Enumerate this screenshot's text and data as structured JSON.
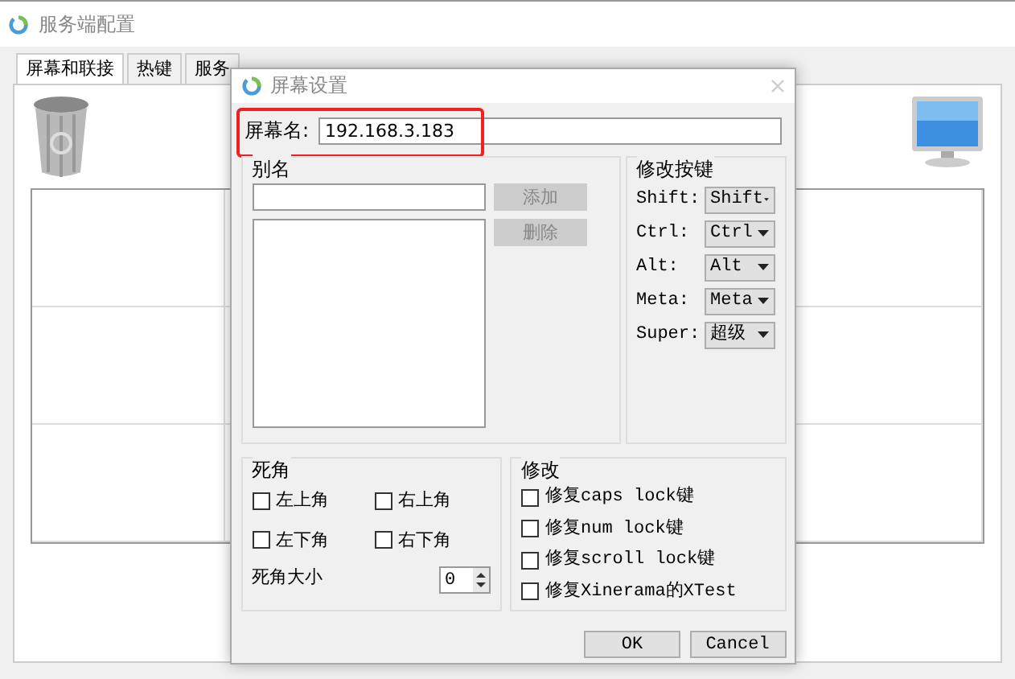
{
  "main_window": {
    "title": "服务端配置",
    "tabs": [
      {
        "label": "屏幕和联接",
        "selected": true
      },
      {
        "label": "热键",
        "selected": false
      },
      {
        "label": "服务",
        "selected": false
      }
    ]
  },
  "dialog": {
    "title": "屏幕设置",
    "screen_name": {
      "label": "屏幕名:",
      "value": "192.168.3.183",
      "highlighted": true
    },
    "aliases": {
      "title": "别名",
      "buttons": [
        {
          "label": "添加",
          "disabled": true
        },
        {
          "label": "删除",
          "disabled": true
        }
      ]
    },
    "modifier_keys": {
      "title": "修改按键",
      "rows": [
        {
          "label": "Shift:",
          "value": "Shift"
        },
        {
          "label": "Ctrl:",
          "value": "Ctrl"
        },
        {
          "label": "Alt:",
          "value": "Alt"
        },
        {
          "label": "Meta:",
          "value": "Meta"
        },
        {
          "label": "Super:",
          "value": "超级"
        }
      ]
    },
    "dead_corners": {
      "title": "死角",
      "corners": [
        {
          "label": "左上角",
          "checked": false
        },
        {
          "label": "右上角",
          "checked": false
        },
        {
          "label": "左下角",
          "checked": false
        },
        {
          "label": "右下角",
          "checked": false
        }
      ],
      "size_label": "死角大小",
      "size_value": "0"
    },
    "fixes": {
      "title": "修改",
      "options": [
        {
          "label": "修复caps lock键",
          "checked": false
        },
        {
          "label": "修复num lock键",
          "checked": false
        },
        {
          "label": "修复scroll lock键",
          "checked": false
        },
        {
          "label": "修复Xinerama的XTest",
          "checked": false
        }
      ]
    },
    "buttons": [
      {
        "label": "OK"
      },
      {
        "label": "Cancel"
      }
    ]
  }
}
